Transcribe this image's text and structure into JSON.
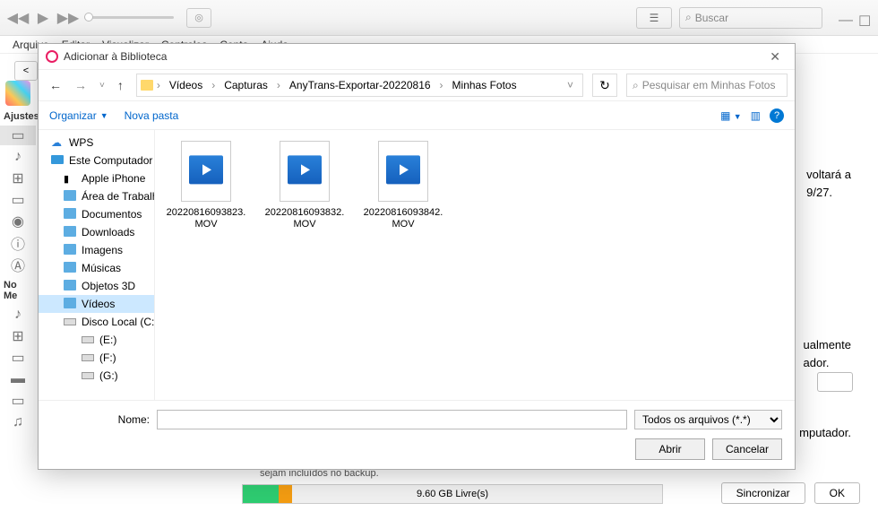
{
  "itunes": {
    "search_placeholder": "Buscar",
    "menubar": [
      "Arquivo",
      "Editar",
      "Visualizar",
      "Controles",
      "Conta",
      "Ajuda"
    ],
    "sidebar": {
      "settings_label": "Ajustes",
      "device_label": "No Me"
    },
    "sync_text1": "voltará a",
    "sync_text2": "9/27.",
    "sync_text3": "ualmente",
    "sync_text4": "ador.",
    "sync_text5": "mputador.",
    "backup_note": "sejam incluídos no backup.",
    "storage_free": "9.60 GB Livre(s)",
    "sync_button": "Sincronizar",
    "ok_button": "OK"
  },
  "dialog": {
    "title": "Adicionar à Biblioteca",
    "breadcrumb": [
      "Vídeos",
      "Capturas",
      "AnyTrans-Exportar-20220816",
      "Minhas Fotos"
    ],
    "search_placeholder": "Pesquisar em Minhas Fotos",
    "organize": "Organizar",
    "new_folder": "Nova pasta",
    "tree": [
      {
        "label": "WPS",
        "icon": "cloud"
      },
      {
        "label": "Este Computador",
        "icon": "pc"
      },
      {
        "label": "Apple iPhone",
        "icon": "phone",
        "indent": true
      },
      {
        "label": "Área de Trabalho",
        "icon": "desktop",
        "indent": true
      },
      {
        "label": "Documentos",
        "icon": "doc",
        "indent": true
      },
      {
        "label": "Downloads",
        "icon": "download",
        "indent": true
      },
      {
        "label": "Imagens",
        "icon": "image",
        "indent": true
      },
      {
        "label": "Músicas",
        "icon": "music",
        "indent": true
      },
      {
        "label": "Objetos 3D",
        "icon": "3d",
        "indent": true
      },
      {
        "label": "Vídeos",
        "icon": "video",
        "indent": true,
        "selected": true
      },
      {
        "label": "Disco Local (C:)",
        "icon": "drive",
        "indent": true
      },
      {
        "label": "(E:)",
        "icon": "drive",
        "indent2": true
      },
      {
        "label": "(F:)",
        "icon": "drive",
        "indent2": true
      },
      {
        "label": "(G:)",
        "icon": "drive",
        "indent2": true
      }
    ],
    "files": [
      {
        "name": "20220816093823.MOV"
      },
      {
        "name": "20220816093832.MOV"
      },
      {
        "name": "20220816093842.MOV"
      }
    ],
    "name_label": "Nome:",
    "name_value": "",
    "filetype": "Todos os arquivos (*.*)",
    "open_btn": "Abrir",
    "cancel_btn": "Cancelar"
  }
}
